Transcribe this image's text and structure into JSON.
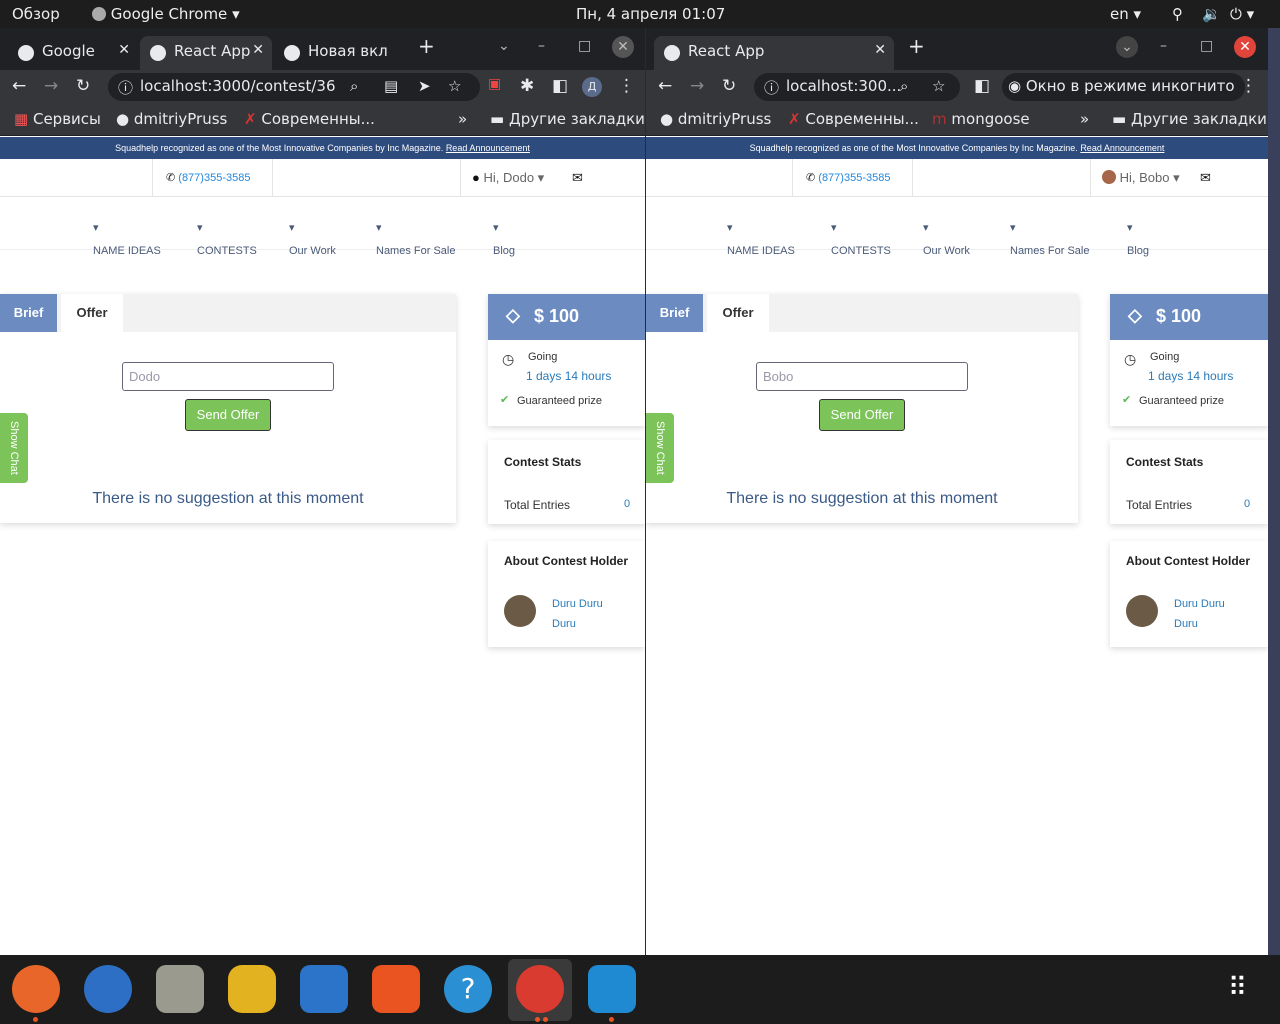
{
  "system": {
    "overview": "Обзор",
    "app": "Google Chrome",
    "datetime": "Пн, 4 апреля  01:07",
    "lang": "en"
  },
  "left": {
    "tabs": [
      "Google",
      "React App",
      "Новая вкл"
    ],
    "url": "localhost:3000/contest/36",
    "profile": "Д",
    "bookmarks": [
      "Сервисы",
      "dmitriyPruss",
      "Современны...",
      "Другие закладки"
    ],
    "banner": "Squadhelp recognized as one of the Most Innovative Companies by Inc Magazine.",
    "banner_link": "Read Announcement",
    "phone": "(877)355-3585",
    "greeting": "Hi, Dodo",
    "input_value": "Dodo"
  },
  "right": {
    "tabs": [
      "React App"
    ],
    "url": "localhost:300...",
    "incognito": "Окно в режиме инкогнито",
    "bookmarks": [
      "dmitriyPruss",
      "Современны...",
      "mongoose",
      "Другие закладки"
    ],
    "banner": "Squadhelp recognized as one of the Most Innovative Companies by Inc Magazine.",
    "banner_link": "Read Announcement",
    "phone": "(877)355-3585",
    "greeting": "Hi, Bobo",
    "input_value": "Bobo"
  },
  "common": {
    "nav": [
      "NAME IDEAS",
      "CONTESTS",
      "Our Work",
      "Names For Sale",
      "Blog"
    ],
    "tab_brief": "Brief",
    "tab_offer": "Offer",
    "send": "Send Offer",
    "nosug": "There is no suggestion at this moment",
    "show_chat": "Show Chat",
    "prize": "$ 100",
    "going": "Going",
    "time": "1 days 14 hours",
    "guaranteed": "Guaranteed prize",
    "stats": "Contest Stats",
    "entries": "Total Entries",
    "entries_n": "0",
    "holder": "About Contest Holder",
    "holder_name1": "Duru Duru",
    "holder_name2": "Duru"
  },
  "taskbar": [
    "firefox-icon",
    "thunderbird-icon",
    "files-icon",
    "rhythmbox-icon",
    "writer-icon",
    "software-icon",
    "help-icon",
    "chrome-icon",
    "vscode-icon"
  ],
  "colors": {
    "brand": "#2e4b7d",
    "accent": "#6b8bc1",
    "green": "#7cc35a"
  }
}
